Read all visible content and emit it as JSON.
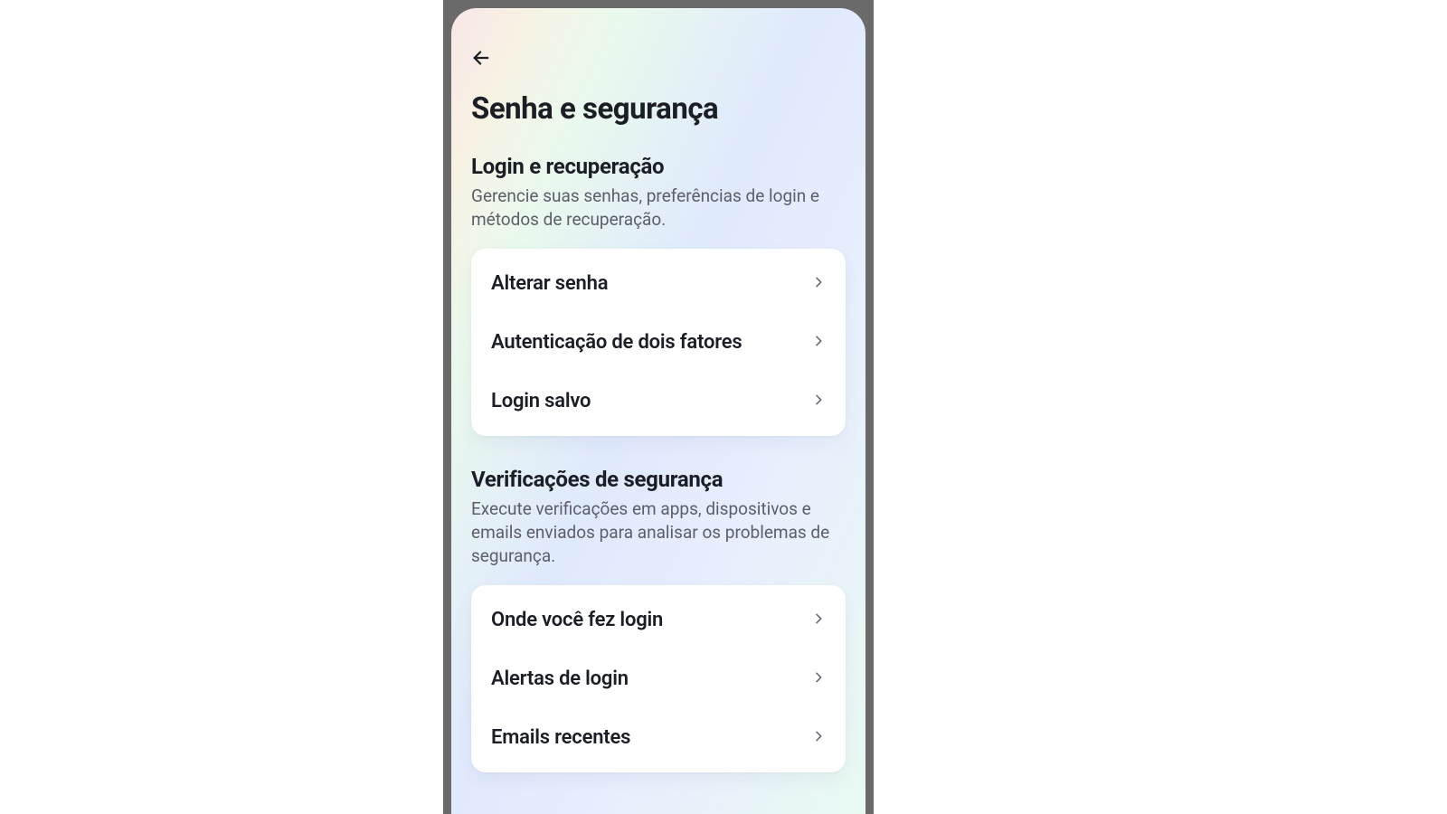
{
  "header": {
    "page_title": "Senha e segurança"
  },
  "sections": [
    {
      "title": "Login e recuperação",
      "description": "Gerencie suas senhas, preferências de login e métodos de recuperação.",
      "items": [
        {
          "label": "Alterar senha"
        },
        {
          "label": "Autenticação de dois fatores"
        },
        {
          "label": "Login salvo"
        }
      ]
    },
    {
      "title": "Verificações de segurança",
      "description": "Execute verificações em apps, dispositivos e emails enviados para analisar os problemas de segurança.",
      "items": [
        {
          "label": "Onde você fez login"
        },
        {
          "label": "Alertas de login"
        },
        {
          "label": "Emails recentes"
        }
      ]
    }
  ]
}
